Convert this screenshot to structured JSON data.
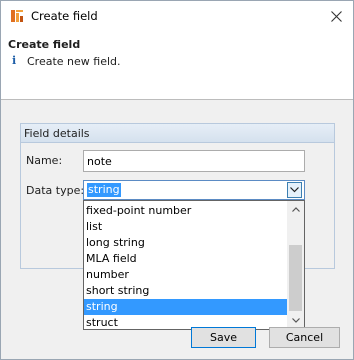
{
  "window": {
    "title": "Create field",
    "icon": "app-icon",
    "close_icon": "close-icon"
  },
  "header": {
    "title": "Create field",
    "info_icon": "info-icon",
    "info_glyph": "i",
    "description": "Create new field."
  },
  "group": {
    "title": "Field details"
  },
  "form": {
    "name_label": "Name:",
    "name_value": "note",
    "datatype_label": "Data type:",
    "datatype_value": "string"
  },
  "dropdown": {
    "items": [
      {
        "label": "fixed-point number",
        "selected": false
      },
      {
        "label": "list",
        "selected": false
      },
      {
        "label": "long string",
        "selected": false
      },
      {
        "label": "MLA field",
        "selected": false
      },
      {
        "label": "number",
        "selected": false
      },
      {
        "label": "short string",
        "selected": false
      },
      {
        "label": "string",
        "selected": true
      },
      {
        "label": "struct",
        "selected": false
      }
    ]
  },
  "buttons": {
    "save_label": "Save",
    "cancel_label": "Cancel"
  },
  "colors": {
    "selection": "#3399ff",
    "info_icon": "#1f5fa8",
    "group_border": "#b8c9dd"
  }
}
